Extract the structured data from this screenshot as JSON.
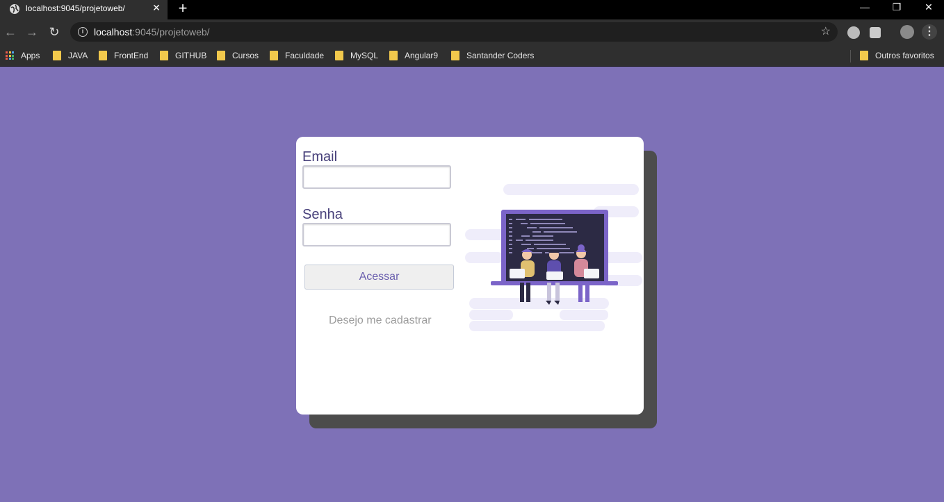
{
  "browser": {
    "tab_title": "localhost:9045/projetoweb/",
    "url_host": "localhost",
    "url_path": ":9045/projetoweb/",
    "bookmarks": [
      "Apps",
      "JAVA",
      "FrontEnd",
      "GITHUB",
      "Cursos",
      "Faculdade",
      "MySQL",
      "Angular9",
      "Santander Coders"
    ],
    "other_bookmarks": "Outros favoritos"
  },
  "login": {
    "email_label": "Email",
    "email_value": "",
    "password_label": "Senha",
    "password_value": "",
    "submit_label": "Acessar",
    "register_link": "Desejo me cadastrar"
  },
  "colors": {
    "page_background": "#7e71b7",
    "card_shadow": "#4c4c4c",
    "accent": "#6a5fae"
  }
}
